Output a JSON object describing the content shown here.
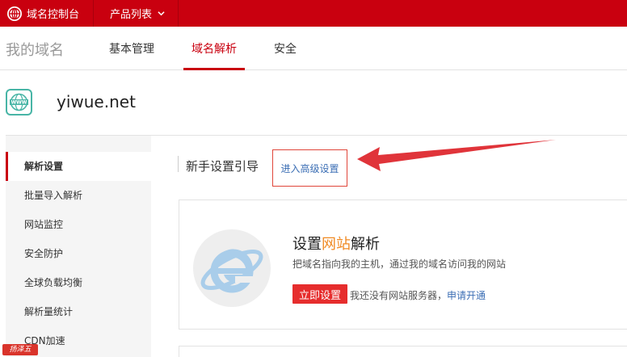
{
  "topbar": {
    "brand_label": "域名控制台",
    "product_menu_label": "产品列表",
    "color": "#c9000f"
  },
  "navbar": {
    "page_title": "我的域名",
    "tabs": [
      {
        "label": "基本管理",
        "active": false
      },
      {
        "label": "域名解析",
        "active": true
      },
      {
        "label": "安全",
        "active": false
      }
    ]
  },
  "domain": {
    "name": "yiwue.net",
    "icon": "www-icon"
  },
  "sidebar": {
    "items": [
      {
        "label": "解析设置",
        "active": true
      },
      {
        "label": "批量导入解析",
        "active": false
      },
      {
        "label": "网站监控",
        "active": false
      },
      {
        "label": "安全防护",
        "active": false
      },
      {
        "label": "全球负载均衡",
        "active": false
      },
      {
        "label": "解析量统计",
        "active": false
      },
      {
        "label": "CDN加速",
        "active": false
      }
    ]
  },
  "main": {
    "section_title": "新手设置引导",
    "advanced_link": "进入高级设置",
    "card": {
      "title_prefix": "设置",
      "title_highlight": "网站",
      "title_suffix": "解析",
      "description": "把域名指向我的主机，通过我的域名访问我的网站",
      "setup_button": "立即设置",
      "no_server_text": "我还没有网站服务器，",
      "apply_link": "申请开通",
      "icon": "ie-icon"
    }
  },
  "watermark": "扬泽五"
}
